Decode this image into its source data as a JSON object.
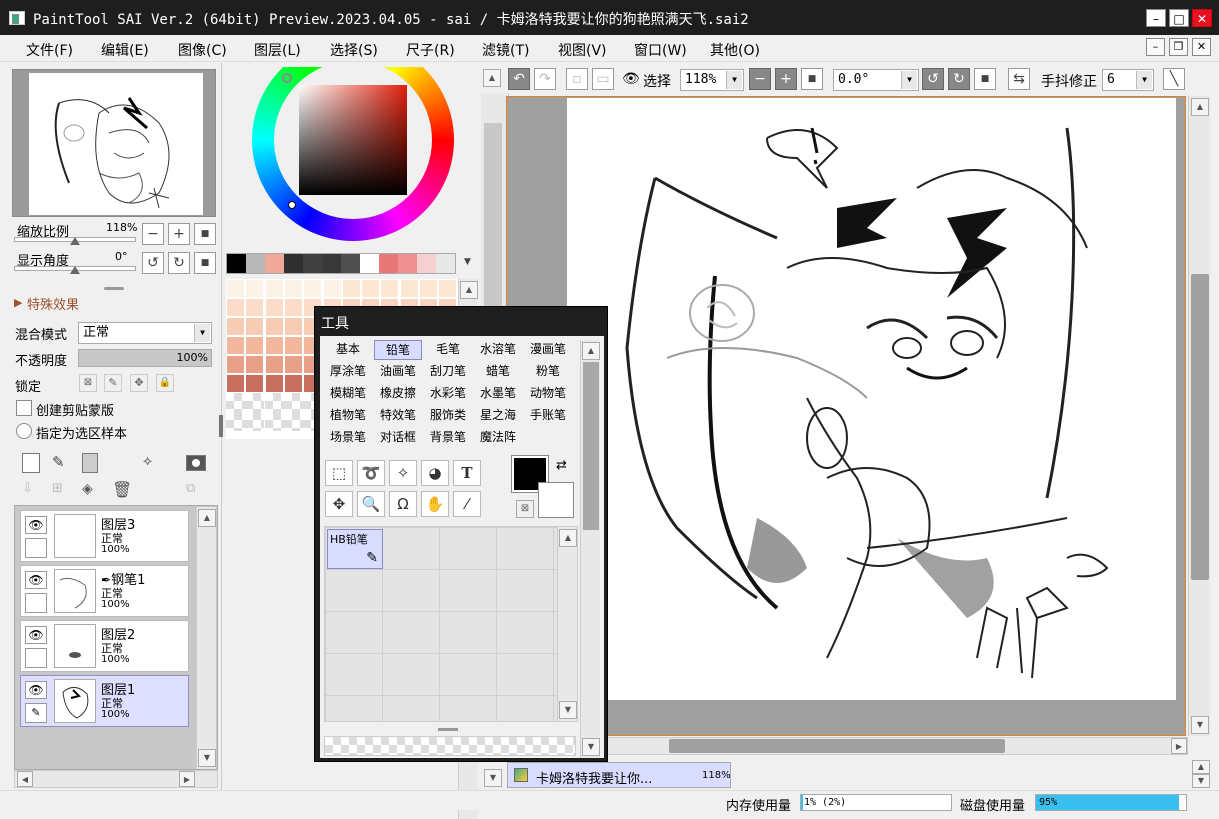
{
  "title": "PaintTool SAI Ver.2 (64bit) Preview.2023.04.05 - sai / 卡姆洛特我要让你的狗艳照满天飞.sai2",
  "window_buttons": {
    "minimize": "–",
    "maximize": "□",
    "close": "✕"
  },
  "menu": [
    "文件(F)",
    "编辑(E)",
    "图像(C)",
    "图层(L)",
    "选择(S)",
    "尺子(R)",
    "滤镜(T)",
    "视图(V)",
    "窗口(W)",
    "其他(O)"
  ],
  "navigator": {
    "zoom_label": "缩放比例",
    "zoom_value": "118%",
    "angle_label": "显示角度",
    "angle_value": "0°"
  },
  "effects": {
    "label": "特殊效果"
  },
  "layer_props": {
    "blend_label": "混合模式",
    "blend_value": "正常",
    "opacity_label": "不透明度",
    "opacity_value": "100%",
    "opacity_fraction": 1.0,
    "lock_label": "锁定",
    "clip_label": "创建剪贴蒙版",
    "sample_label": "指定为选区样本"
  },
  "layers": [
    {
      "name": "图层3",
      "mode": "正常",
      "opacity": "100%",
      "selected": false,
      "pen": false
    },
    {
      "name": "钢笔1",
      "mode": "正常",
      "opacity": "100%",
      "selected": false,
      "pen": true
    },
    {
      "name": "图层2",
      "mode": "正常",
      "opacity": "100%",
      "selected": false,
      "pen": false
    },
    {
      "name": "图层1",
      "mode": "正常",
      "opacity": "100%",
      "selected": true,
      "pen": false
    }
  ],
  "swatch_row": [
    "#000000",
    "#b8b8b8",
    "#f0a898",
    "#303030",
    "#404040",
    "#383838",
    "#505050",
    "#ffffff",
    "#e87878",
    "#f09090",
    "#f4d0d0",
    "#e8e8e8"
  ],
  "palette_colors": [
    "#fdf2e8",
    "#fce6d4",
    "#fadcc8",
    "#f8d4c0",
    "#f6ccb4",
    "#f4c2a8",
    "#f2b89e",
    "#eeae94",
    "#e8a088",
    "#dc8c76",
    "#c87060",
    "#b45a4c"
  ],
  "tools_panel": {
    "title": "工具",
    "tabs": [
      "基本",
      "铅笔",
      "毛笔",
      "水溶笔",
      "漫画笔",
      "厚涂笔",
      "油画笔",
      "刮刀笔",
      "蜡笔",
      "粉笔",
      "模糊笔",
      "橡皮擦",
      "水彩笔",
      "水墨笔",
      "动物笔",
      "植物笔",
      "特效笔",
      "服饰类",
      "星之海",
      "手账笔",
      "场景笔",
      "对话框",
      "背景笔",
      "魔法阵"
    ],
    "selected_tab": "铅笔",
    "brush": "HB铅笔",
    "text_tool_glyph": "T"
  },
  "toolbar": {
    "select_label": "选择",
    "zoom_value": "118%",
    "angle_value": "0.0°",
    "stabilizer_label": "手抖修正",
    "stabilizer_value": "6"
  },
  "document_tab": {
    "name": "卡姆洛特我要让你...",
    "zoom": "118%"
  },
  "status": {
    "memory_label": "内存使用量",
    "memory_value": "1% (2%)",
    "memory_fraction": 0.01,
    "disk_label": "磁盘使用量",
    "disk_value": "95%",
    "disk_fraction": 0.95
  },
  "colors": {
    "current_color": "#000000",
    "secondary_color": "#ffffff",
    "selection_accent": "#d8dcff"
  }
}
